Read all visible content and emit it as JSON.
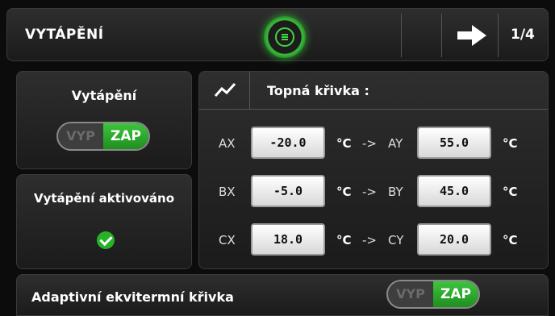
{
  "header": {
    "title": "VYTÁPĚNÍ",
    "page_indicator": "1/4"
  },
  "heating": {
    "label": "Vytápění",
    "toggle": {
      "off_label": "VYP",
      "on_label": "ZAP",
      "state": "on"
    }
  },
  "activated": {
    "label": "Vytápění aktivováno",
    "status": "checked"
  },
  "curve": {
    "title": "Topná křivka :",
    "rows": [
      {
        "in_label": "AX",
        "in_value": "-20.0",
        "unit1": "°C",
        "arrow": "->",
        "out_label": "AY",
        "out_value": "55.0",
        "unit2": "°C"
      },
      {
        "in_label": "BX",
        "in_value": "-5.0",
        "unit1": "°C",
        "arrow": "->",
        "out_label": "BY",
        "out_value": "45.0",
        "unit2": "°C"
      },
      {
        "in_label": "CX",
        "in_value": "18.0",
        "unit1": "°C",
        "arrow": "->",
        "out_label": "CY",
        "out_value": "20.0",
        "unit2": "°C"
      }
    ]
  },
  "adaptive": {
    "label": "Adaptivní ekvitermní křivka",
    "toggle": {
      "off_label": "VYP",
      "on_label": "ZAP",
      "state": "on"
    }
  },
  "colors": {
    "accent": "#2eaa2e",
    "background": "#0c0c0c",
    "panel": "#262626"
  },
  "icons": [
    "menu-icon",
    "arrow-right-icon",
    "chart-icon",
    "check-icon"
  ]
}
